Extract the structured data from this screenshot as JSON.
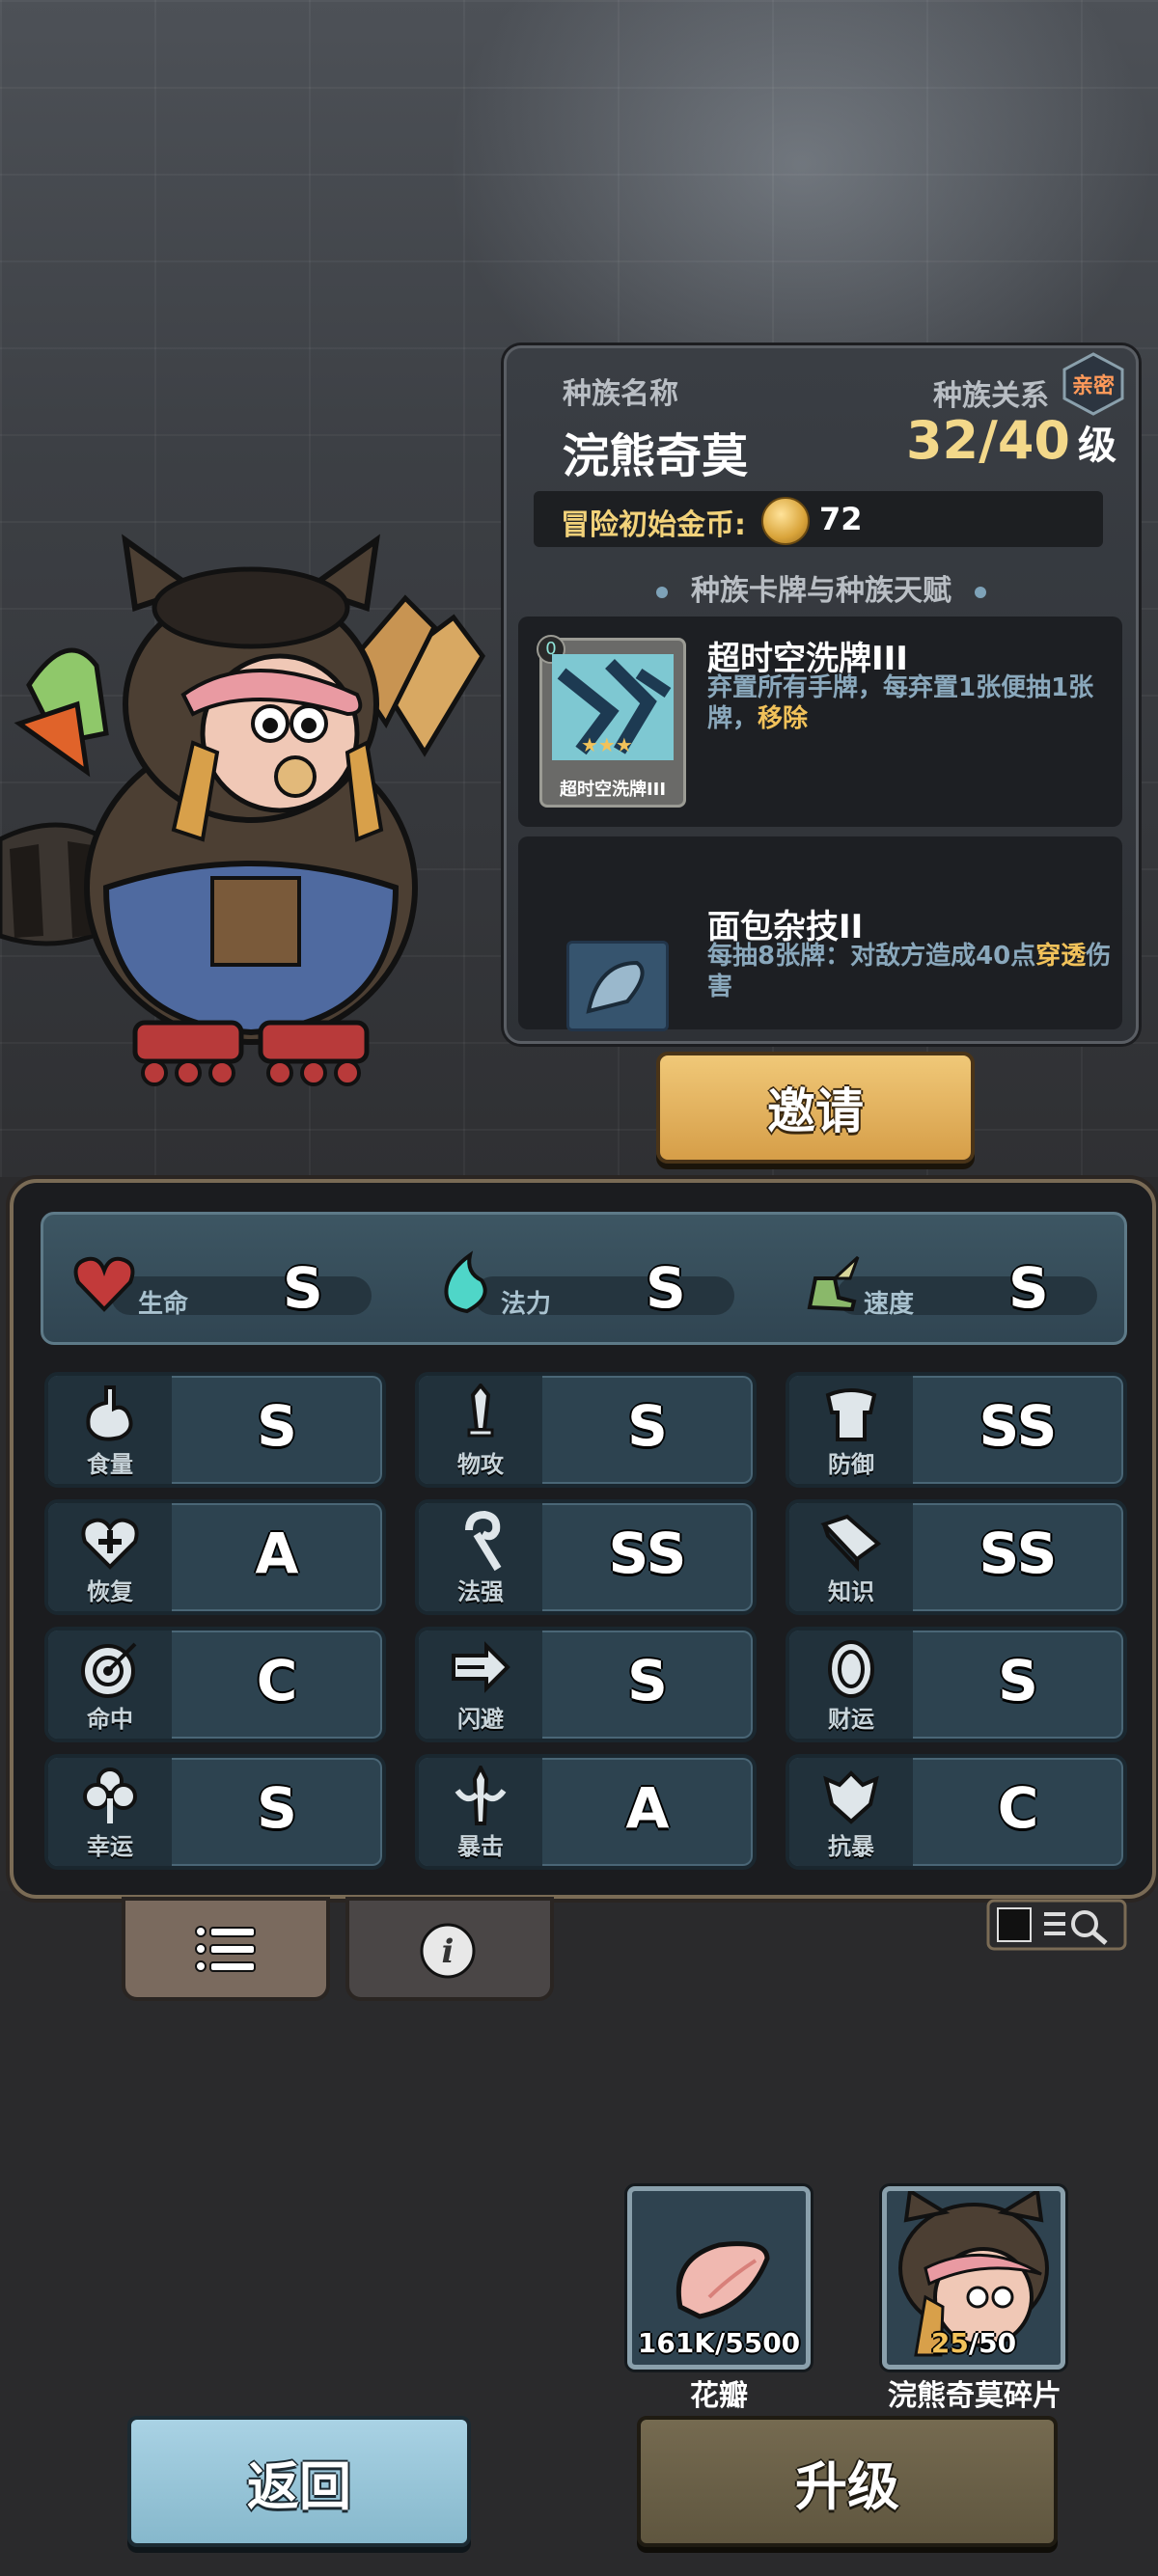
{
  "race": {
    "name_label": "种族名称",
    "name": "浣熊奇莫",
    "relation_label": "种族关系",
    "relation_badge": "亲密",
    "level_current": "32/40",
    "level_unit": "级",
    "gold_label": "冒险初始金币:",
    "gold_value": "72",
    "section_title": "种族卡牌与种族天赋"
  },
  "card": {
    "cost": "0",
    "title": "超时空洗牌III",
    "art_name": "超时空洗牌III",
    "desc_main": "弃置所有手牌，每弃置1张便抽1张牌，",
    "desc_keyword": "移除"
  },
  "talent": {
    "title": "面包杂技II",
    "desc_main": "每抽8张牌：对敌方造成40点",
    "desc_keyword": "穿透",
    "desc_tail": "伤害"
  },
  "invite_label": "邀请",
  "top_stats": [
    {
      "icon": "heart-icon",
      "label": "生命",
      "grade": "S"
    },
    {
      "icon": "mana-flame-icon",
      "label": "法力",
      "grade": "S"
    },
    {
      "icon": "winged-boot-icon",
      "label": "速度",
      "grade": "S"
    }
  ],
  "stats": [
    {
      "icon": "stomach-icon",
      "label": "食量",
      "grade": "S"
    },
    {
      "icon": "sword-icon",
      "label": "物攻",
      "grade": "S"
    },
    {
      "icon": "armor-icon",
      "label": "防御",
      "grade": "SS"
    },
    {
      "icon": "heart-plus-icon",
      "label": "恢复",
      "grade": "A"
    },
    {
      "icon": "staff-icon",
      "label": "法强",
      "grade": "SS"
    },
    {
      "icon": "book-icon",
      "label": "知识",
      "grade": "SS"
    },
    {
      "icon": "target-icon",
      "label": "命中",
      "grade": "C"
    },
    {
      "icon": "dash-arrow-icon",
      "label": "闪避",
      "grade": "S"
    },
    {
      "icon": "coin-icon",
      "label": "财运",
      "grade": "S"
    },
    {
      "icon": "clover-icon",
      "label": "幸运",
      "grade": "S"
    },
    {
      "icon": "dagger-icon",
      "label": "暴击",
      "grade": "A"
    },
    {
      "icon": "shield-crest-icon",
      "label": "抗暴",
      "grade": "C"
    }
  ],
  "materials": [
    {
      "name": "花瓣",
      "count_current": "161K",
      "count_required": "/5500"
    },
    {
      "name": "浣熊奇莫碎片",
      "count_current": "25",
      "count_required": "/50"
    }
  ],
  "buttons": {
    "back": "返回",
    "upgrade": "升级"
  },
  "colors": {
    "accent_gold": "#f2c25a",
    "panel_teal": "#2d4350",
    "level_gold": "#f3d88a"
  }
}
